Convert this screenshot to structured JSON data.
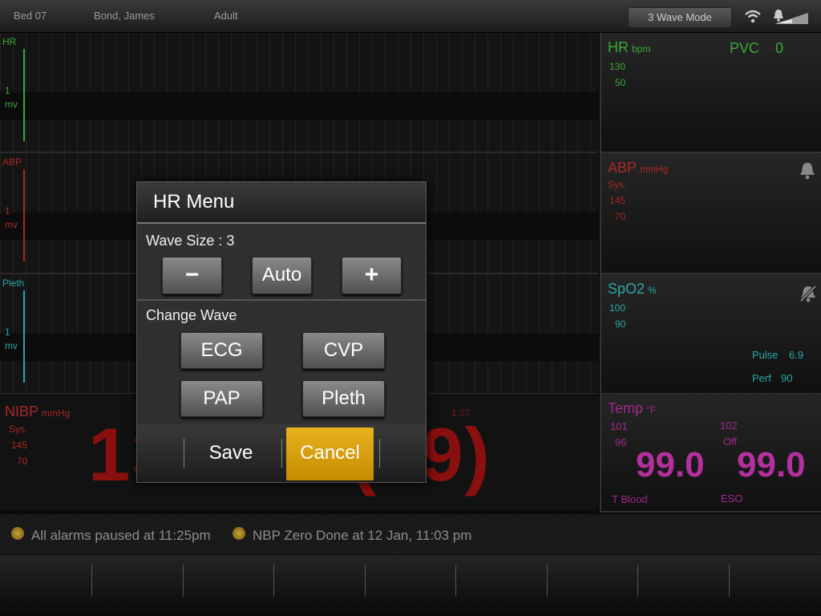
{
  "topbar": {
    "bed": "Bed 07",
    "patient": "Bond, James",
    "category": "Adult",
    "wave_mode": "3 Wave Mode"
  },
  "waves": {
    "hr": {
      "label": "HR",
      "mv1": "1",
      "mv2": "mv",
      "color": "#3aa83a"
    },
    "abp": {
      "label": "ABP",
      "mv1": "1",
      "mv2": "mv",
      "color": "#a82828"
    },
    "pleth": {
      "label": "Pleth",
      "mv1": "1",
      "mv2": "mv",
      "color": "#2aa6a6"
    }
  },
  "params": {
    "hr": {
      "name": "HR",
      "unit": "bpm",
      "pvc_label": "PVC",
      "pvc_value": "0",
      "high": "130",
      "low": "50"
    },
    "abp": {
      "name": "ABP",
      "unit": "mmHg",
      "sys": "Sys.",
      "high": "145",
      "low": "70"
    },
    "spo2": {
      "name": "SpO2",
      "unit": "%",
      "high": "100",
      "low": "90",
      "pulse_label": "Pulse",
      "pulse_value": "6.9",
      "perf_label": "Perf",
      "perf_value": "90"
    },
    "temp": {
      "name": "Temp",
      "unit": "°F",
      "high1": "101",
      "low1": "96",
      "high2": "102",
      "low2": "Off",
      "value1": "99.0",
      "value2": "99.0",
      "label1": "T Blood",
      "label2": "ESO"
    }
  },
  "nibp": {
    "name": "NIBP",
    "unit": "mmHg",
    "sys": "Sys.",
    "high": "145",
    "low": "70",
    "time": "1:07",
    "value_left": "130/90",
    "value_right": "(99)"
  },
  "status": {
    "msg1": "All alarms paused at 11:25pm",
    "msg2": "NBP Zero Done at 12 Jan, 11:03 pm"
  },
  "dialog": {
    "title": "HR Menu",
    "wave_size_label": "Wave Size : 3",
    "minus": "−",
    "auto": "Auto",
    "plus": "+",
    "change_wave_label": "Change Wave",
    "waves": [
      "ECG",
      "CVP",
      "PAP",
      "Pleth"
    ],
    "save": "Save",
    "cancel": "Cancel"
  }
}
